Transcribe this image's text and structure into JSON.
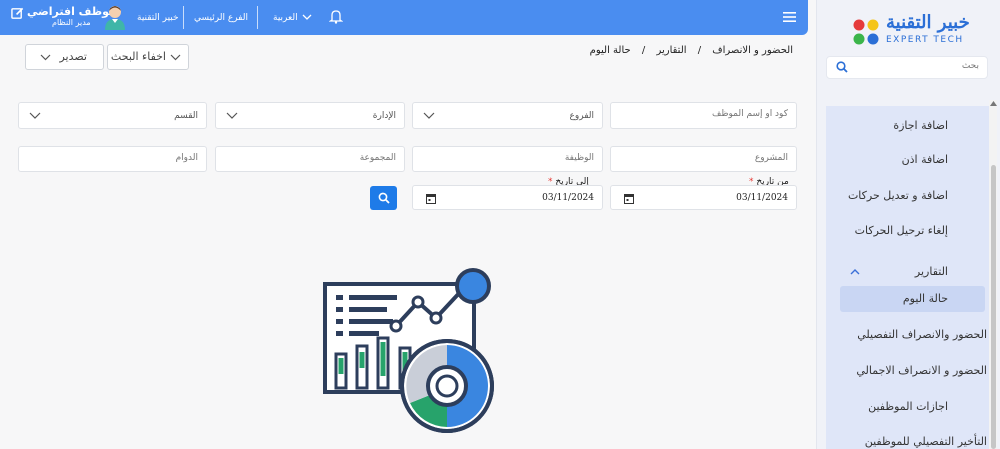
{
  "header": {
    "user_name": "موظف افتراضي",
    "user_role": "مدير النظام",
    "company": "خبير التقنية",
    "branch": "الفرع الرئيسي",
    "language": "العربية"
  },
  "sidebar": {
    "logo_ar": "خبير التقنية",
    "logo_en": "EXPERT TECH",
    "search_placeholder": "بحث",
    "items": [
      {
        "label": "اضافة اجازة"
      },
      {
        "label": "اضافة اذن"
      },
      {
        "label": "اضافة و تعديل حركات"
      },
      {
        "label": "إلغاء ترحيل الحركات"
      },
      {
        "label": "التقارير"
      },
      {
        "label": "حالة اليوم"
      },
      {
        "label": "الحضور والانصراف التفصيلي"
      },
      {
        "label": "الحضور و الانصراف الاجمالي"
      },
      {
        "label": "اجازات الموظفين"
      },
      {
        "label": "التأخير التفصيلي للموظفين"
      }
    ]
  },
  "breadcrumb": {
    "level1": "الحضور و الانصراف",
    "level2": "التقارير",
    "level3": "حالة اليوم",
    "separator": "/"
  },
  "toolbar": {
    "hide_search": "اخفاء البحث",
    "export": "تصدير"
  },
  "filters": {
    "employee_placeholder": "كود او إسم الموظف",
    "branches_placeholder": "الفروع",
    "management_placeholder": "الإدارة",
    "department_placeholder": "القسم",
    "project_placeholder": "المشروع",
    "job_placeholder": "الوظيفة",
    "group_placeholder": "المجموعة",
    "shift_placeholder": "الدوام",
    "from_date_label": "من تاريخ",
    "to_date_label": "إلى تاريخ",
    "required_mark": "*",
    "from_date": "03/11/2024",
    "to_date": "03/11/2024"
  },
  "colors": {
    "topbar": "#4a8df0",
    "primary_button": "#1e7be8",
    "sidebar_active": "#c9d6f3",
    "menu_panel": "#dfe6f8",
    "illustration_navy": "#2d3e5c",
    "illustration_blue": "#3a86e0",
    "illustration_green": "#27a36b"
  }
}
